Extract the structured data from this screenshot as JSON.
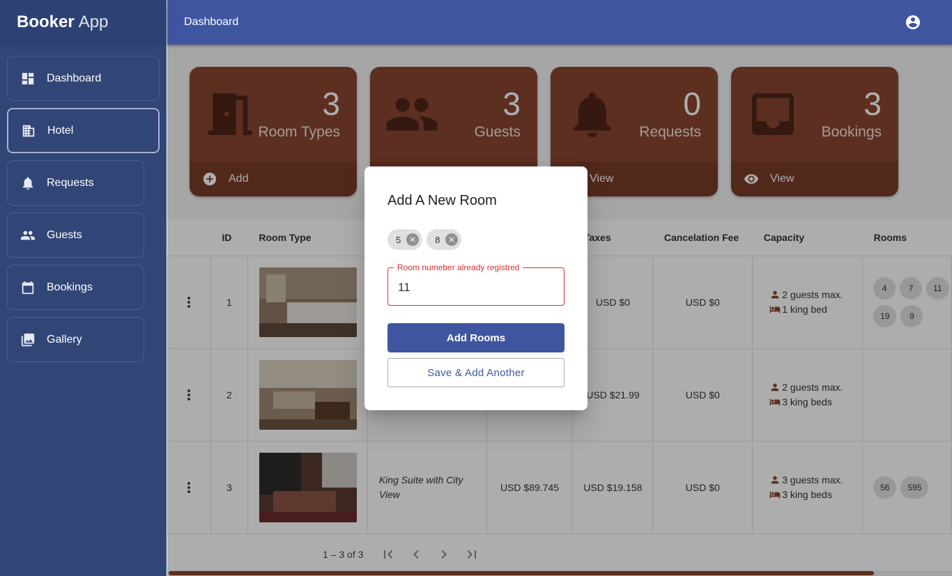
{
  "app": {
    "brand_bold": "Booker",
    "brand_light": "App"
  },
  "topbar": {
    "title": "Dashboard"
  },
  "sidebar": {
    "items": [
      {
        "label": "Dashboard",
        "icon": "dashboard-icon"
      },
      {
        "label": "Hotel",
        "icon": "building-icon",
        "active": true
      },
      {
        "label": "Requests",
        "icon": "bell-icon"
      },
      {
        "label": "Guests",
        "icon": "people-icon"
      },
      {
        "label": "Bookings",
        "icon": "calendar-icon"
      },
      {
        "label": "Gallery",
        "icon": "photo-icon"
      }
    ]
  },
  "cards": [
    {
      "count": "3",
      "label": "Room Types",
      "action": "Add",
      "icon": "door-icon",
      "action_icon": "add-circle-icon"
    },
    {
      "count": "3",
      "label": "Guests",
      "action": "",
      "icon": "people-icon",
      "action_icon": ""
    },
    {
      "count": "0",
      "label": "Requests",
      "action": "View",
      "icon": "bell-icon",
      "action_icon": "eye-icon"
    },
    {
      "count": "3",
      "label": "Bookings",
      "action": "View",
      "icon": "inbox-icon",
      "action_icon": "eye-icon"
    }
  ],
  "table": {
    "headers": {
      "id": "ID",
      "room_type": "Room Type",
      "taxes": "Taxes",
      "cancel_fee": "Cancelation Fee",
      "capacity": "Capacity",
      "rooms": "Rooms"
    },
    "rows": [
      {
        "id": "1",
        "name": "",
        "price": "",
        "taxes": "USD $0",
        "cancel_fee": "USD $0",
        "guests": "2 guests max.",
        "beds": "1 king bed",
        "rooms": [
          "4",
          "7",
          "11",
          "19",
          "9"
        ]
      },
      {
        "id": "2",
        "name": "",
        "price": "",
        "taxes": "USD $21.99",
        "cancel_fee": "USD $0",
        "guests": "2 guests max.",
        "beds": "3 king beds",
        "rooms": []
      },
      {
        "id": "3",
        "name": "King Suite with City View",
        "price": "USD $89.745",
        "taxes": "USD $19.158",
        "cancel_fee": "USD $0",
        "guests": "3 guests max.",
        "beds": "3 king beds",
        "rooms": [
          "56",
          "595"
        ]
      }
    ],
    "paginator": {
      "range": "1 – 3 of 3"
    }
  },
  "dialog": {
    "title": "Add A New Room",
    "chips": [
      "5",
      "8"
    ],
    "field_label": "Room numeber already registred",
    "field_value": "11",
    "primary_button": "Add Rooms",
    "secondary_button": "Save & Add Another"
  },
  "colors": {
    "sidebar": "#314577",
    "topbar": "#3f55a0",
    "card": "#8a4630",
    "error": "#d32f2f"
  }
}
